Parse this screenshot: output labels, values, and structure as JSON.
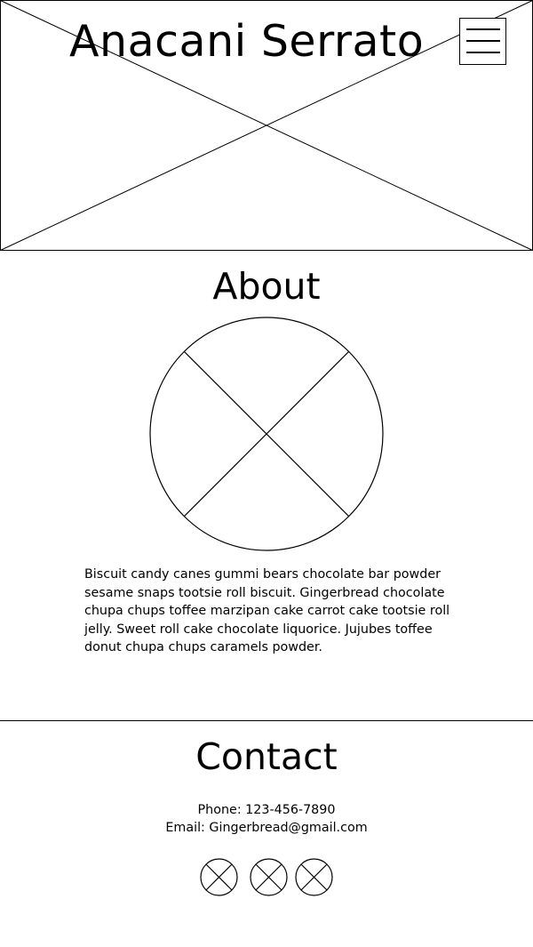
{
  "header": {
    "site_title": "Anacani Serrato",
    "menu_icon": "hamburger-menu-icon"
  },
  "about": {
    "title": "About",
    "body": "Biscuit candy canes gummi bears chocolate bar powder sesame snaps tootsie roll biscuit. Gingerbread chocolate chupa chups toffee marzipan cake carrot cake tootsie roll jelly. Sweet roll cake chocolate liquorice. Jujubes toffee donut chupa chups caramels powder."
  },
  "contact": {
    "title": "Contact",
    "phone": "Phone: 123-456-7890",
    "email": "Email: Gingerbread@gmail.com",
    "social_icons": [
      "social-icon-placeholder",
      "social-icon-placeholder",
      "social-icon-placeholder"
    ]
  },
  "colors": {
    "line": "#000000",
    "background": "#ffffff"
  }
}
